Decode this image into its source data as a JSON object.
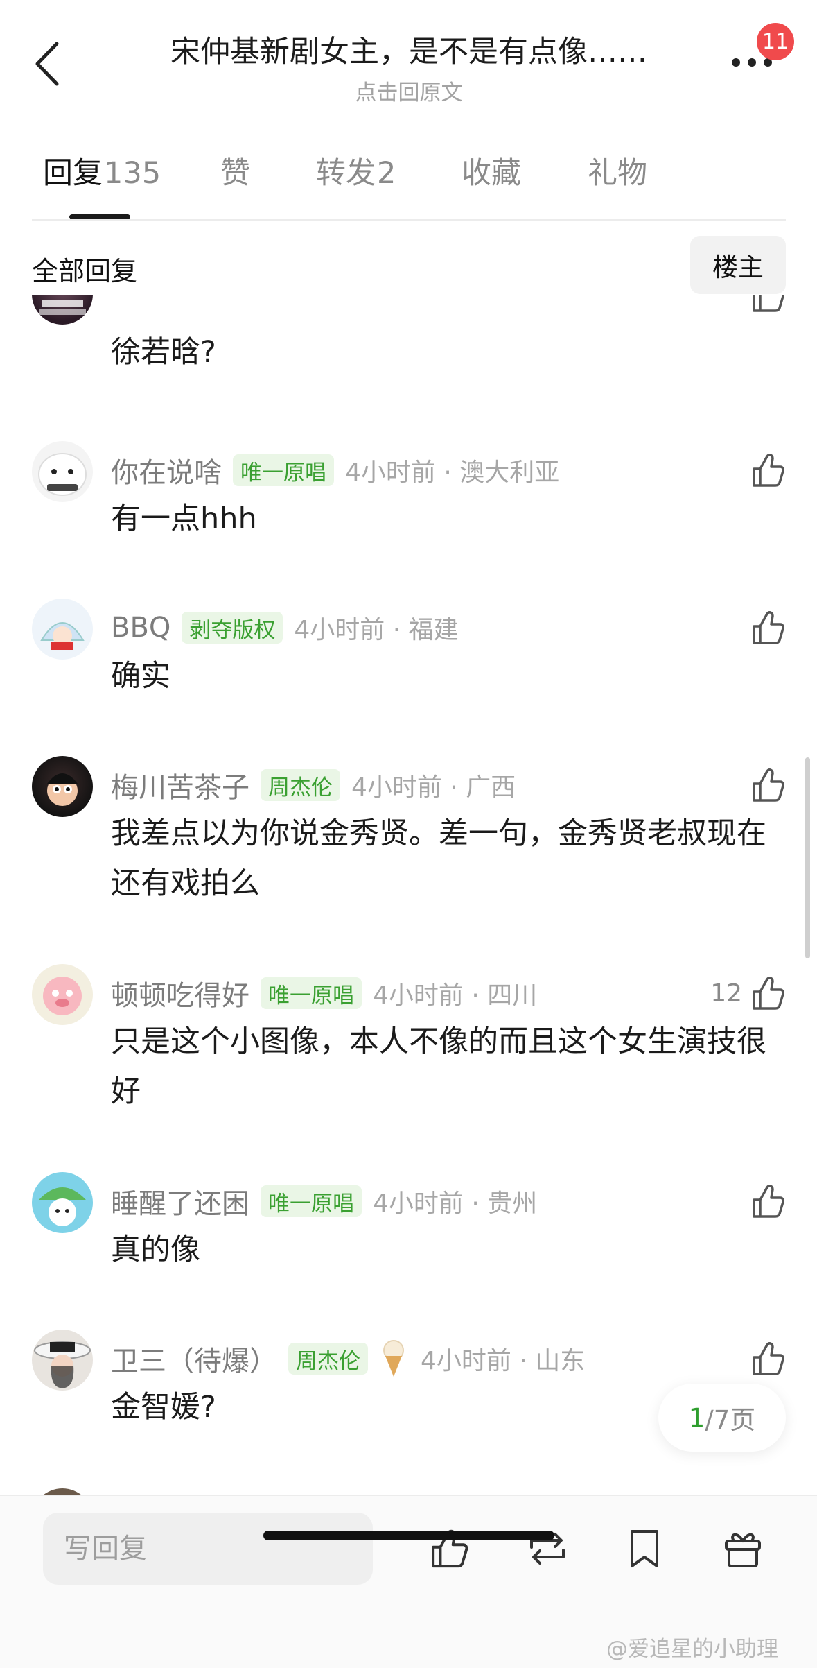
{
  "header": {
    "title": "宋仲基新剧女主，是不是有点像……",
    "subtitle": "点击回原文",
    "notification_count": "11"
  },
  "tabs": [
    {
      "label": "回复",
      "count": "135",
      "active": true
    },
    {
      "label": "赞",
      "count": "",
      "active": false
    },
    {
      "label": "转发",
      "count": "2",
      "active": false
    },
    {
      "label": "收藏",
      "count": "",
      "active": false
    },
    {
      "label": "礼物",
      "count": "",
      "active": false
    }
  ],
  "filter": {
    "label": "全部回复",
    "owner_button": "楼主"
  },
  "comments": [
    {
      "username": "",
      "tag": "",
      "time_loc": "",
      "text": "徐若晗?",
      "likes": ""
    },
    {
      "username": "你在说啥",
      "tag": "唯一原唱",
      "time_loc": "4小时前 · 澳大利亚",
      "text": "有一点hhh",
      "likes": ""
    },
    {
      "username": "BBQ",
      "tag": "剥夺版权",
      "time_loc": "4小时前 · 福建",
      "text": "确实",
      "likes": ""
    },
    {
      "username": "梅川苦茶子",
      "tag": "周杰伦",
      "time_loc": "4小时前 · 广西",
      "text": "我差点以为你说金秀贤。差一句，金秀贤老叔现在还有戏拍么",
      "likes": ""
    },
    {
      "username": "顿顿吃得好",
      "tag": "唯一原唱",
      "time_loc": "4小时前 · 四川",
      "text": "只是这个小图像，本人不像的而且这个女生演技很好",
      "likes": "12"
    },
    {
      "username": "睡醒了还困",
      "tag": "唯一原唱",
      "time_loc": "4小时前 · 贵州",
      "text": "真的像",
      "likes": ""
    },
    {
      "username": "卫三（待爆）",
      "tag": "周杰伦",
      "time_loc": "4小时前 · 山东",
      "text": "金智媛?",
      "likes": ""
    }
  ],
  "pager": {
    "current": "1",
    "total_text": "/7页"
  },
  "bottom_bar": {
    "reply_placeholder": "写回复"
  },
  "watermark": "@爱追星的小助理",
  "colors": {
    "tag_bg": "#eaf6e6",
    "tag_text": "#3aa031",
    "badge": "#f04a4c",
    "pager_current": "#2e9e2e"
  },
  "icons": [
    "back-icon",
    "more-icon",
    "like-icon",
    "repost-icon",
    "bookmark-icon",
    "gift-icon",
    "ice-cream-icon"
  ]
}
